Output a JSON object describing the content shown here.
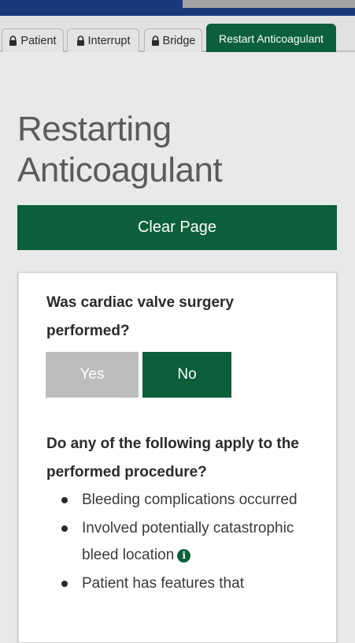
{
  "tabs": [
    {
      "label": "Patient",
      "icon": "lock-icon"
    },
    {
      "label": "Interrupt",
      "icon": "lock-icon"
    },
    {
      "label": "Bridge",
      "icon": "lock-icon"
    },
    {
      "label": "Restart Anticoagulant",
      "active": true
    }
  ],
  "page": {
    "title_line1": "Restarting",
    "title_line2": "Anticoagulant",
    "clear_button": "Clear Page"
  },
  "question1": {
    "text": "Was cardiac valve surgery performed?",
    "yes_label": "Yes",
    "no_label": "No",
    "selected": "No"
  },
  "question2": {
    "text": "Do any of the following apply to the performed procedure?",
    "items": [
      "Bleeding complications occurred",
      "Involved potentially catastrophic bleed location",
      "Patient has features that"
    ]
  },
  "colors": {
    "primary_green": "#0b5f39",
    "nav_blue": "#19397a",
    "unselected_gray": "#bdbdbd"
  }
}
